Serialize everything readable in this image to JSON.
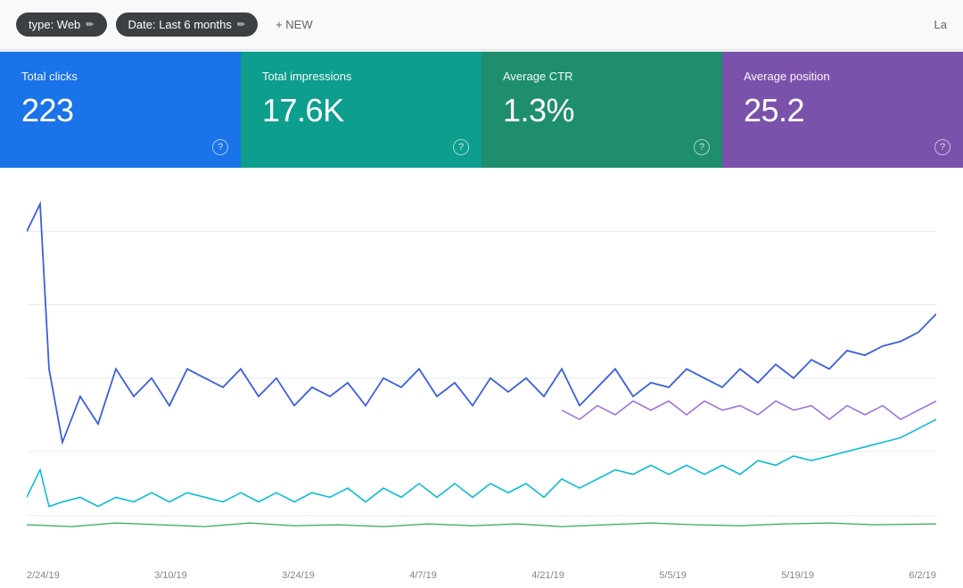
{
  "toolbar": {
    "filter1_label": "type: Web",
    "filter1_edit": "✏",
    "filter2_label": "Date: Last 6 months",
    "filter2_edit": "✏",
    "new_button": "+ NEW",
    "right_label": "La"
  },
  "metrics": [
    {
      "id": "clicks",
      "label": "Total clicks",
      "value": "223",
      "color_class": "clicks",
      "help": "?"
    },
    {
      "id": "impressions",
      "label": "Total impressions",
      "value": "17.6K",
      "color_class": "impressions",
      "help": "?"
    },
    {
      "id": "ctr",
      "label": "Average CTR",
      "value": "1.3%",
      "color_class": "ctr",
      "help": "?"
    },
    {
      "id": "position",
      "label": "Average position",
      "value": "25.2",
      "color_class": "position",
      "help": "?"
    }
  ],
  "chart": {
    "x_labels": [
      "2/24/19",
      "3/10/19",
      "3/24/19",
      "4/7/19",
      "4/21/19",
      "5/5/19",
      "5/19/19",
      "6/2/19"
    ],
    "series": {
      "clicks_color": "#4285f4",
      "impressions_color": "#0f9d8a",
      "ctr_color": "#34a853",
      "position_color": "#7b52ab"
    }
  }
}
